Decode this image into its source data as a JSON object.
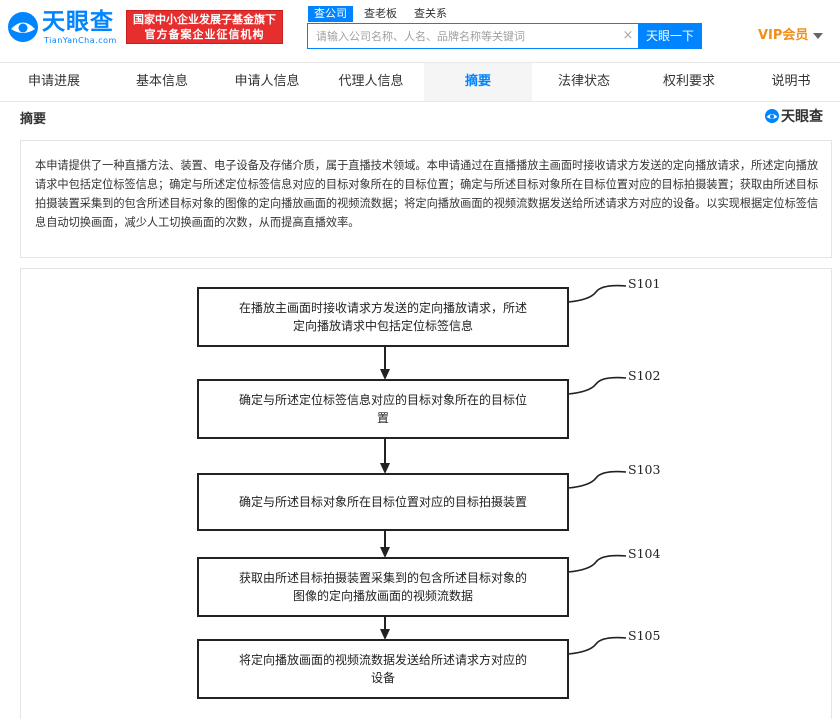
{
  "header": {
    "logo_text": "天眼查",
    "logo_sub": "TianYanCha.com",
    "banner_line1": "国家中小企业发展子基金旗下",
    "banner_line2": "官方备案企业征信机构",
    "search_tabs": [
      "查公司",
      "查老板",
      "查关系"
    ],
    "search_placeholder": "请输入公司名称、人名、品牌名称等关键词",
    "search_button": "天眼一下",
    "vip_label": "VIP会员"
  },
  "tabs": [
    "申请进展",
    "基本信息",
    "申请人信息",
    "代理人信息",
    "摘要",
    "法律状态",
    "权利要求",
    "说明书"
  ],
  "active_tab_index": 4,
  "section": {
    "title": "摘要",
    "brand": "天眼查",
    "abstract": "本申请提供了一种直播方法、装置、电子设备及存储介质，属于直播技术领域。本申请通过在直播播放主画面时接收请求方发送的定向播放请求，所述定向播放请求中包括定位标签信息；确定与所述定位标签信息对应的目标对象所在的目标位置；确定与所述目标对象所在目标位置对应的目标拍摄装置；获取由所述目标拍摄装置采集到的包含所述目标对象的图像的定向播放画面的视频流数据；将定向播放画面的视频流数据发送给所述请求方对应的设备。以实现根据定位标签信息自动切换画面，减少人工切换画面的次数，从而提高直播效率。"
  },
  "flowchart": {
    "steps": [
      {
        "label": "S101",
        "lines": [
          "在播放主画面时接收请求方发送的定向播放请求，所述",
          "定向播放请求中包括定位标签信息"
        ]
      },
      {
        "label": "S102",
        "lines": [
          "确定与所述定位标签信息对应的目标对象所在的目标位",
          "置"
        ]
      },
      {
        "label": "S103",
        "lines": [
          "确定与所述目标对象所在目标位置对应的目标拍摄装置"
        ]
      },
      {
        "label": "S104",
        "lines": [
          "获取由所述目标拍摄装置采集到的包含所述目标对象的",
          "图像的定向播放画面的视频流数据"
        ]
      },
      {
        "label": "S105",
        "lines": [
          "将定向播放画面的视频流数据发送给所述请求方对应的",
          "设备"
        ]
      }
    ]
  },
  "colors": {
    "brand_blue": "#0084ff",
    "banner_red": "#e62e2e",
    "vip_orange": "#f28e16"
  }
}
